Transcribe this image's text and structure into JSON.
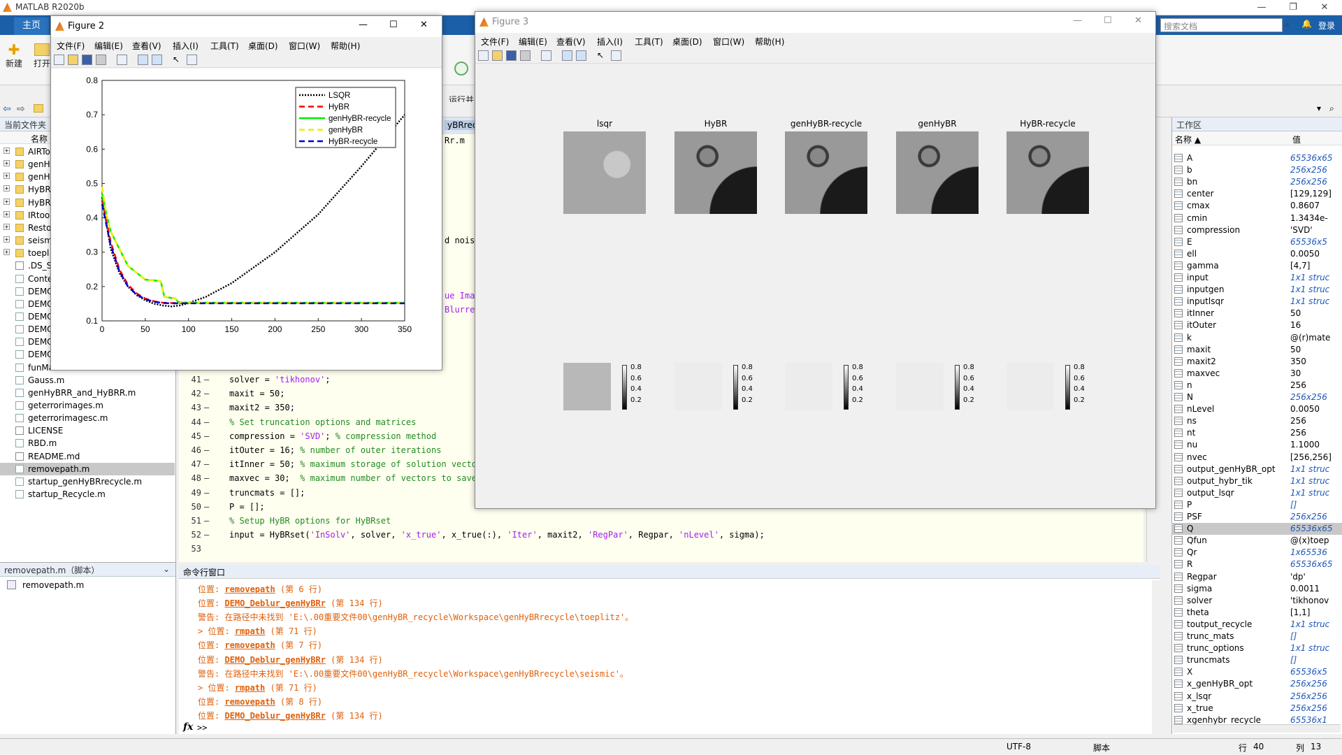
{
  "app": {
    "title": "MATLAB R2020b"
  },
  "ribbon": {
    "home_tab": "主页",
    "search_placeholder": "搜索文档",
    "login": "登录",
    "new_label": "新建",
    "open_label": "打开",
    "run_time_label": "运行并\n计时"
  },
  "folder_panel": {
    "title": "当前文件夹",
    "col_name": "名称",
    "items": [
      {
        "name": "AIRTo",
        "type": "folder"
      },
      {
        "name": "genH",
        "type": "folder"
      },
      {
        "name": "genH",
        "type": "folder"
      },
      {
        "name": "HyBR",
        "type": "folder"
      },
      {
        "name": "HyBR",
        "type": "folder"
      },
      {
        "name": "IRtoo",
        "type": "folder"
      },
      {
        "name": "Resto",
        "type": "folder"
      },
      {
        "name": "seism",
        "type": "folder"
      },
      {
        "name": "toepl",
        "type": "folder"
      },
      {
        "name": ".DS_S",
        "type": "file"
      },
      {
        "name": "Conte",
        "type": "m"
      },
      {
        "name": "DEMO",
        "type": "m"
      },
      {
        "name": "DEMO",
        "type": "m"
      },
      {
        "name": "DEMO",
        "type": "m"
      },
      {
        "name": "DEMO",
        "type": "m"
      },
      {
        "name": "DEMO",
        "type": "m"
      },
      {
        "name": "DEMO_Tomo_genHyBRr.m",
        "type": "m"
      },
      {
        "name": "funMat.m",
        "type": "m"
      },
      {
        "name": "Gauss.m",
        "type": "m"
      },
      {
        "name": "genHyBRR_and_HyBRR.m",
        "type": "m"
      },
      {
        "name": "geterrorimages.m",
        "type": "m"
      },
      {
        "name": "geterrorimagesc.m",
        "type": "m"
      },
      {
        "name": "LICENSE",
        "type": "file"
      },
      {
        "name": "RBD.m",
        "type": "m"
      },
      {
        "name": "README.md",
        "type": "file"
      },
      {
        "name": "removepath.m",
        "type": "m",
        "selected": true
      },
      {
        "name": "startup_genHyBRrecycle.m",
        "type": "m"
      },
      {
        "name": "startup_Recycle.m",
        "type": "m"
      }
    ]
  },
  "detail_panel": {
    "header": "removepath.m（脚本）",
    "item": "removepath.m"
  },
  "editor": {
    "tab_fragment": "yBRrecy",
    "tab_fragment2": "Rr.m",
    "partial_lines": [
      {
        "text": "d noise"
      },
      {
        "text": "ue Ima"
      },
      {
        "text": "Blurre"
      }
    ],
    "lines": [
      {
        "no": "41",
        "parts": [
          {
            "t": "solver = "
          },
          {
            "t": "'tikhonov'",
            "c": "str"
          },
          {
            "t": ";"
          }
        ]
      },
      {
        "no": "42",
        "parts": [
          {
            "t": "maxit = 50;"
          }
        ]
      },
      {
        "no": "43",
        "parts": [
          {
            "t": "maxit2 = 350;"
          }
        ]
      },
      {
        "no": "44",
        "parts": [
          {
            "t": "% Set truncation options and matrices",
            "c": "cm"
          }
        ]
      },
      {
        "no": "45",
        "parts": [
          {
            "t": "compression = "
          },
          {
            "t": "'SVD'",
            "c": "str"
          },
          {
            "t": "; "
          },
          {
            "t": "% compression method",
            "c": "cm"
          }
        ]
      },
      {
        "no": "46",
        "parts": [
          {
            "t": "itOuter = 16; "
          },
          {
            "t": "% number of outer iterations",
            "c": "cm"
          }
        ]
      },
      {
        "no": "47",
        "parts": [
          {
            "t": "itInner = 50; "
          },
          {
            "t": "% maximum storage of solution vector",
            "c": "cm"
          }
        ]
      },
      {
        "no": "48",
        "parts": [
          {
            "t": "maxvec = 30;  "
          },
          {
            "t": "% maximum number of vectors to save",
            "c": "cm"
          }
        ]
      },
      {
        "no": "49",
        "parts": [
          {
            "t": "truncmats = [];"
          }
        ]
      },
      {
        "no": "50",
        "parts": [
          {
            "t": "P = [];"
          }
        ]
      },
      {
        "no": "51",
        "parts": [
          {
            "t": "% Setup HyBR options for HyBRset",
            "c": "cm"
          }
        ]
      },
      {
        "no": "52",
        "parts": [
          {
            "t": "input = HyBRset("
          },
          {
            "t": "'InSolv'",
            "c": "str"
          },
          {
            "t": ", solver, "
          },
          {
            "t": "'x_true'",
            "c": "str"
          },
          {
            "t": ", x_true(:), "
          },
          {
            "t": "'Iter'",
            "c": "str"
          },
          {
            "t": ", maxit2, "
          },
          {
            "t": "'RegPar'",
            "c": "str"
          },
          {
            "t": ", Regpar, "
          },
          {
            "t": "'nLevel'",
            "c": "str"
          },
          {
            "t": ", sigma);"
          }
        ]
      },
      {
        "no": "53",
        "parts": [
          {
            "t": ""
          }
        ]
      }
    ]
  },
  "command_window": {
    "title": "命令行窗口",
    "prompt": ">>",
    "lines": [
      {
        "pre": "位置: ",
        "link": "removepath",
        "post": " (第 6 行)"
      },
      {
        "pre": "位置: ",
        "link": "DEMO_Deblur_genHyBRr",
        "post": " (第 134 行)"
      },
      {
        "pre": "警告: 在路径中未找到 'E:\\.00重要文件00\\genHyBR_recycle\\Workspace\\genHyBRrecycle\\toeplitz'。",
        "link": "",
        "post": ""
      },
      {
        "pre": "> 位置: ",
        "link": "rmpath",
        "post": " (第 71 行)"
      },
      {
        "pre": "位置: ",
        "link": "removepath",
        "post": " (第 7 行)"
      },
      {
        "pre": "位置: ",
        "link": "DEMO_Deblur_genHyBRr",
        "post": " (第 134 行)"
      },
      {
        "pre": "警告: 在路径中未找到 'E:\\.00重要文件00\\genHyBR_recycle\\Workspace\\genHyBRrecycle\\seismic'。",
        "link": "",
        "post": ""
      },
      {
        "pre": "> 位置: ",
        "link": "rmpath",
        "post": " (第 71 行)"
      },
      {
        "pre": "位置: ",
        "link": "removepath",
        "post": " (第 8 行)"
      },
      {
        "pre": "位置: ",
        "link": "DEMO_Deblur_genHyBRr",
        "post": " (第 134 行)"
      }
    ]
  },
  "workspace": {
    "title": "工作区",
    "col_name": "名称 ▲",
    "col_value": "值",
    "vars": [
      {
        "n": "A",
        "v": "65536x65",
        "it": true
      },
      {
        "n": "b",
        "v": "256x256",
        "it": true
      },
      {
        "n": "bn",
        "v": "256x256",
        "it": true
      },
      {
        "n": "center",
        "v": "[129,129]"
      },
      {
        "n": "cmax",
        "v": "0.8607"
      },
      {
        "n": "cmin",
        "v": "1.3434e-"
      },
      {
        "n": "compression",
        "v": "'SVD'"
      },
      {
        "n": "E",
        "v": "65536x5",
        "it": true
      },
      {
        "n": "ell",
        "v": "0.0050"
      },
      {
        "n": "gamma",
        "v": "[4,7]"
      },
      {
        "n": "input",
        "v": "1x1 struc",
        "it": true
      },
      {
        "n": "inputgen",
        "v": "1x1 struc",
        "it": true
      },
      {
        "n": "inputlsqr",
        "v": "1x1 struc",
        "it": true
      },
      {
        "n": "itInner",
        "v": "50"
      },
      {
        "n": "itOuter",
        "v": "16"
      },
      {
        "n": "k",
        "v": "@(r)mate"
      },
      {
        "n": "maxit",
        "v": "50"
      },
      {
        "n": "maxit2",
        "v": "350"
      },
      {
        "n": "maxvec",
        "v": "30"
      },
      {
        "n": "n",
        "v": "256"
      },
      {
        "n": "N",
        "v": "256x256",
        "it": true
      },
      {
        "n": "nLevel",
        "v": "0.0050"
      },
      {
        "n": "ns",
        "v": "256"
      },
      {
        "n": "nt",
        "v": "256"
      },
      {
        "n": "nu",
        "v": "1.1000"
      },
      {
        "n": "nvec",
        "v": "[256,256]"
      },
      {
        "n": "output_genHyBR_opt",
        "v": "1x1 struc",
        "it": true
      },
      {
        "n": "output_hybr_tik",
        "v": "1x1 struc",
        "it": true
      },
      {
        "n": "output_lsqr",
        "v": "1x1 struc",
        "it": true
      },
      {
        "n": "P",
        "v": "[]",
        "it": true
      },
      {
        "n": "PSF",
        "v": "256x256",
        "it": true
      },
      {
        "n": "Q",
        "v": "65536x65",
        "it": true,
        "sel": true
      },
      {
        "n": "Qfun",
        "v": "@(x)toep"
      },
      {
        "n": "Qr",
        "v": "1x65536",
        "it": true
      },
      {
        "n": "R",
        "v": "65536x65",
        "it": true
      },
      {
        "n": "Regpar",
        "v": "'dp'"
      },
      {
        "n": "sigma",
        "v": "0.0011"
      },
      {
        "n": "solver",
        "v": "'tikhonov"
      },
      {
        "n": "theta",
        "v": "[1,1]"
      },
      {
        "n": "toutput_recycle",
        "v": "1x1 struc",
        "it": true
      },
      {
        "n": "trunc_mats",
        "v": "[]",
        "it": true
      },
      {
        "n": "trunc_options",
        "v": "1x1 struc",
        "it": true
      },
      {
        "n": "truncmats",
        "v": "[]",
        "it": true
      },
      {
        "n": "X",
        "v": "65536x5",
        "it": true
      },
      {
        "n": "x_genHyBR_opt",
        "v": "256x256",
        "it": true
      },
      {
        "n": "x_lsqr",
        "v": "256x256",
        "it": true
      },
      {
        "n": "x_true",
        "v": "256x256",
        "it": true
      },
      {
        "n": "xgenhybr_recycle",
        "v": "65536x1",
        "it": true
      }
    ]
  },
  "status": {
    "encoding": "UTF-8",
    "type": "脚本",
    "row_label": "行",
    "row": "40",
    "col_label": "列",
    "col": "13"
  },
  "figure_menu": [
    "文件(F)",
    "编辑(E)",
    "查看(V)",
    "插入(I)",
    "工具(T)",
    "桌面(D)",
    "窗口(W)",
    "帮助(H)"
  ],
  "figure2": {
    "title": "Figure 2",
    "chart_data": {
      "type": "line",
      "xlim": [
        0,
        350
      ],
      "ylim": [
        0.1,
        0.8
      ],
      "xticks": [
        0,
        50,
        100,
        150,
        200,
        250,
        300,
        350
      ],
      "yticks": [
        0.1,
        0.2,
        0.3,
        0.4,
        0.5,
        0.6,
        0.7,
        0.8
      ],
      "legend_position": "top-right",
      "series": [
        {
          "name": "LSQR",
          "color": "#000000",
          "dash": "dotted",
          "x": [
            0,
            10,
            20,
            30,
            40,
            50,
            60,
            70,
            80,
            90,
            100,
            120,
            150,
            200,
            250,
            300,
            330,
            350
          ],
          "y": [
            0.46,
            0.31,
            0.24,
            0.2,
            0.175,
            0.16,
            0.15,
            0.145,
            0.142,
            0.145,
            0.152,
            0.17,
            0.21,
            0.3,
            0.41,
            0.55,
            0.64,
            0.7
          ]
        },
        {
          "name": "HyBR",
          "color": "#ff0000",
          "dash": "dashed",
          "x": [
            0,
            10,
            20,
            30,
            40,
            50,
            60,
            70,
            80,
            90,
            100,
            150,
            200,
            250,
            300,
            350
          ],
          "y": [
            0.45,
            0.33,
            0.25,
            0.205,
            0.18,
            0.165,
            0.157,
            0.153,
            0.152,
            0.152,
            0.152,
            0.152,
            0.152,
            0.152,
            0.152,
            0.152
          ]
        },
        {
          "name": "genHyBR-recycle",
          "color": "#00ee00",
          "dash": "solid",
          "x": [
            0,
            5,
            10,
            20,
            30,
            40,
            50,
            60,
            68,
            72,
            85,
            88,
            100,
            150,
            200,
            250,
            300,
            350
          ],
          "y": [
            0.47,
            0.41,
            0.36,
            0.31,
            0.26,
            0.24,
            0.22,
            0.218,
            0.215,
            0.17,
            0.165,
            0.155,
            0.153,
            0.153,
            0.153,
            0.153,
            0.153,
            0.153
          ]
        },
        {
          "name": "genHyBR",
          "color": "#eeee00",
          "dash": "dashed",
          "x": [
            0,
            5,
            10,
            20,
            30,
            40,
            50,
            60,
            68,
            72,
            85,
            88,
            100,
            150,
            200,
            250,
            300,
            350
          ],
          "y": [
            0.49,
            0.41,
            0.36,
            0.31,
            0.26,
            0.24,
            0.22,
            0.218,
            0.215,
            0.17,
            0.165,
            0.155,
            0.153,
            0.153,
            0.153,
            0.153,
            0.153,
            0.153
          ]
        },
        {
          "name": "HyBR-recycle",
          "color": "#0000cc",
          "dash": "dashed",
          "x": [
            0,
            10,
            20,
            30,
            40,
            50,
            60,
            70,
            80,
            90,
            100,
            150,
            200,
            250,
            300,
            350
          ],
          "y": [
            0.44,
            0.32,
            0.245,
            0.2,
            0.177,
            0.163,
            0.156,
            0.152,
            0.151,
            0.151,
            0.151,
            0.151,
            0.151,
            0.151,
            0.151,
            0.151
          ]
        }
      ]
    }
  },
  "figure3": {
    "title": "Figure 3",
    "images": [
      {
        "label": "lsqr",
        "tone": "light"
      },
      {
        "label": "HyBR",
        "tone": "dark"
      },
      {
        "label": "genHyBR-recycle",
        "tone": "dark"
      },
      {
        "label": "genHyBR",
        "tone": "dark"
      },
      {
        "label": "HyBR-recycle",
        "tone": "dark"
      }
    ],
    "colorbar_ticks": [
      "0.8",
      "0.6",
      "0.4",
      "0.2"
    ]
  }
}
